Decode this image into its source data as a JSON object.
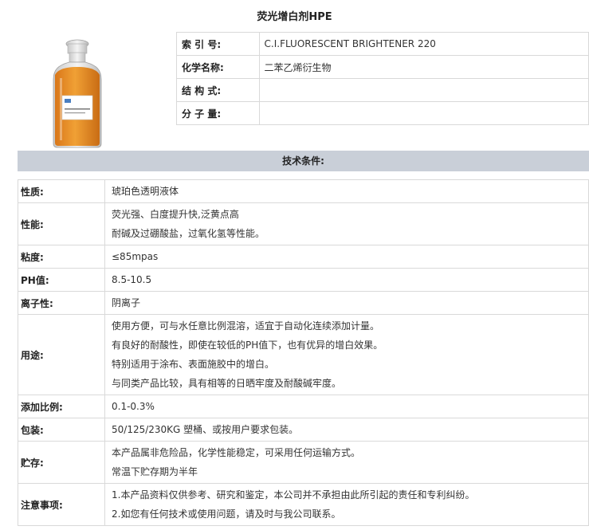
{
  "title": "荧光增白剂HPE",
  "product_image": {
    "icon": "bottle-image",
    "liquid_color": "#e8901e",
    "label_text": "荧光增白剂 HPE"
  },
  "info_table": [
    {
      "label": "索 引 号:",
      "value": "C.I.FLUORESCENT BRIGHTENER 220"
    },
    {
      "label": "化学名称:",
      "value": "二苯乙烯衍生物"
    },
    {
      "label": "结 构 式:",
      "value": ""
    },
    {
      "label": "分 子 量:",
      "value": ""
    }
  ],
  "section_title": "技术条件:",
  "spec_rows": [
    {
      "label": "性质:",
      "lines": [
        "琥珀色透明液体"
      ]
    },
    {
      "label": "性能:",
      "lines": [
        "荧光强、白度提升快,泛黄点高",
        "耐碱及过硼酸盐，过氧化氢等性能。"
      ]
    },
    {
      "label": "粘度:",
      "lines": [
        "≤85mpas"
      ]
    },
    {
      "label": "PH值:",
      "lines": [
        "8.5-10.5"
      ]
    },
    {
      "label": "离子性:",
      "lines": [
        "阴离子"
      ]
    },
    {
      "label": "用途:",
      "lines": [
        "使用方便，可与水任意比例混溶，适宜于自动化连续添加计量。",
        "有良好的耐酸性，即使在较低的PH值下，也有优异的增白效果。",
        "特别适用于涂布、表面施胶中的增白。",
        "与同类产品比较，具有相等的日晒牢度及耐酸碱牢度。"
      ]
    },
    {
      "label": "添加比例:",
      "lines": [
        "0.1-0.3%"
      ]
    },
    {
      "label": "包装:",
      "lines": [
        "50/125/230KG 塑桶、或按用户要求包装。"
      ]
    },
    {
      "label": "贮存:",
      "lines": [
        "本产品属非危险品，化学性能稳定，可采用任何运输方式。",
        "常温下贮存期为半年"
      ]
    },
    {
      "label": "注意事项:",
      "lines": [
        "1.本产品资料仅供参考、研究和鉴定，本公司并不承担由此所引起的责任和专利纠纷。",
        "2.如您有任何技术或使用问题，请及时与我公司联系。"
      ]
    }
  ]
}
